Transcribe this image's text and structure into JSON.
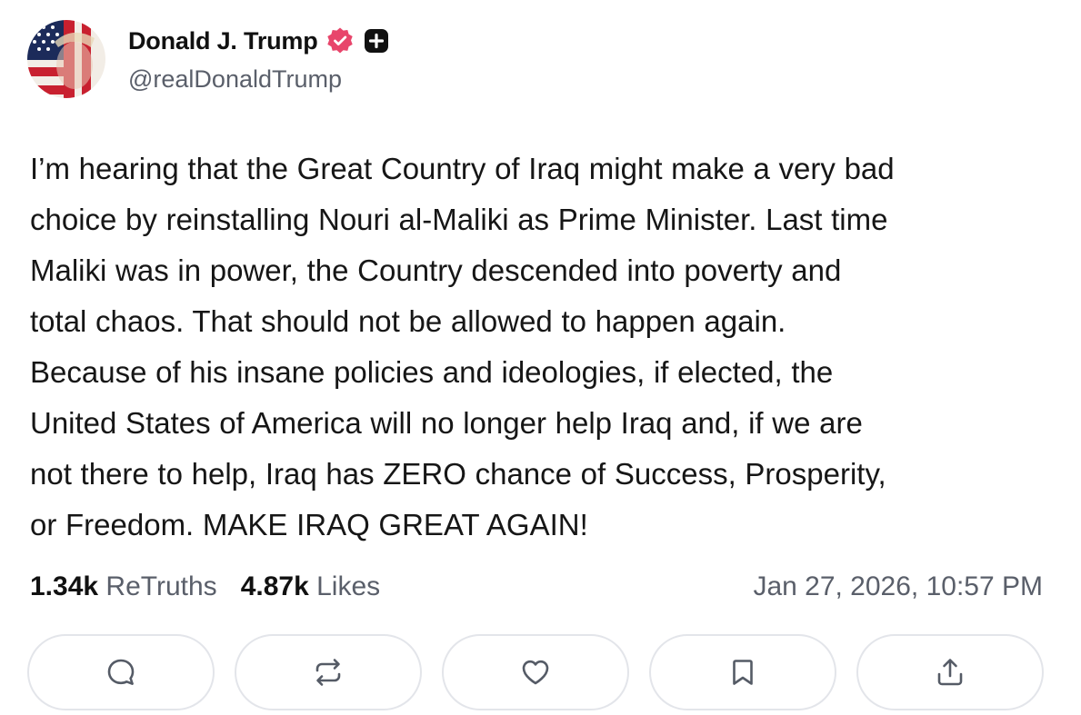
{
  "author": {
    "display_name": "Donald J. Trump",
    "handle": "@realDonaldTrump",
    "verified_icon": "verified-badge-icon",
    "plus_icon": "plus-badge-icon",
    "verified_color": "#e8456b"
  },
  "post": {
    "text": "I’m hearing that the Great Country of Iraq might make a very bad\nchoice by reinstalling Nouri al-Maliki as Prime Minister. Last time\nMaliki was in power, the Country descended into poverty and\ntotal chaos. That should not be allowed to happen again.\nBecause of his insane policies and ideologies, if elected, the\nUnited States of America will no longer help Iraq and, if we are\nnot there to help, Iraq has ZERO chance of Success, Prosperity,\nor Freedom. MAKE IRAQ GREAT AGAIN!"
  },
  "stats": {
    "retruths_count": "1.34k",
    "retruths_label": "ReTruths",
    "likes_count": "4.87k",
    "likes_label": "Likes",
    "timestamp": "Jan 27, 2026, 10:57 PM"
  },
  "actions": [
    {
      "icon": "reply-icon"
    },
    {
      "icon": "retruth-icon"
    },
    {
      "icon": "like-heart-icon"
    },
    {
      "icon": "bookmark-icon"
    },
    {
      "icon": "share-icon"
    }
  ]
}
